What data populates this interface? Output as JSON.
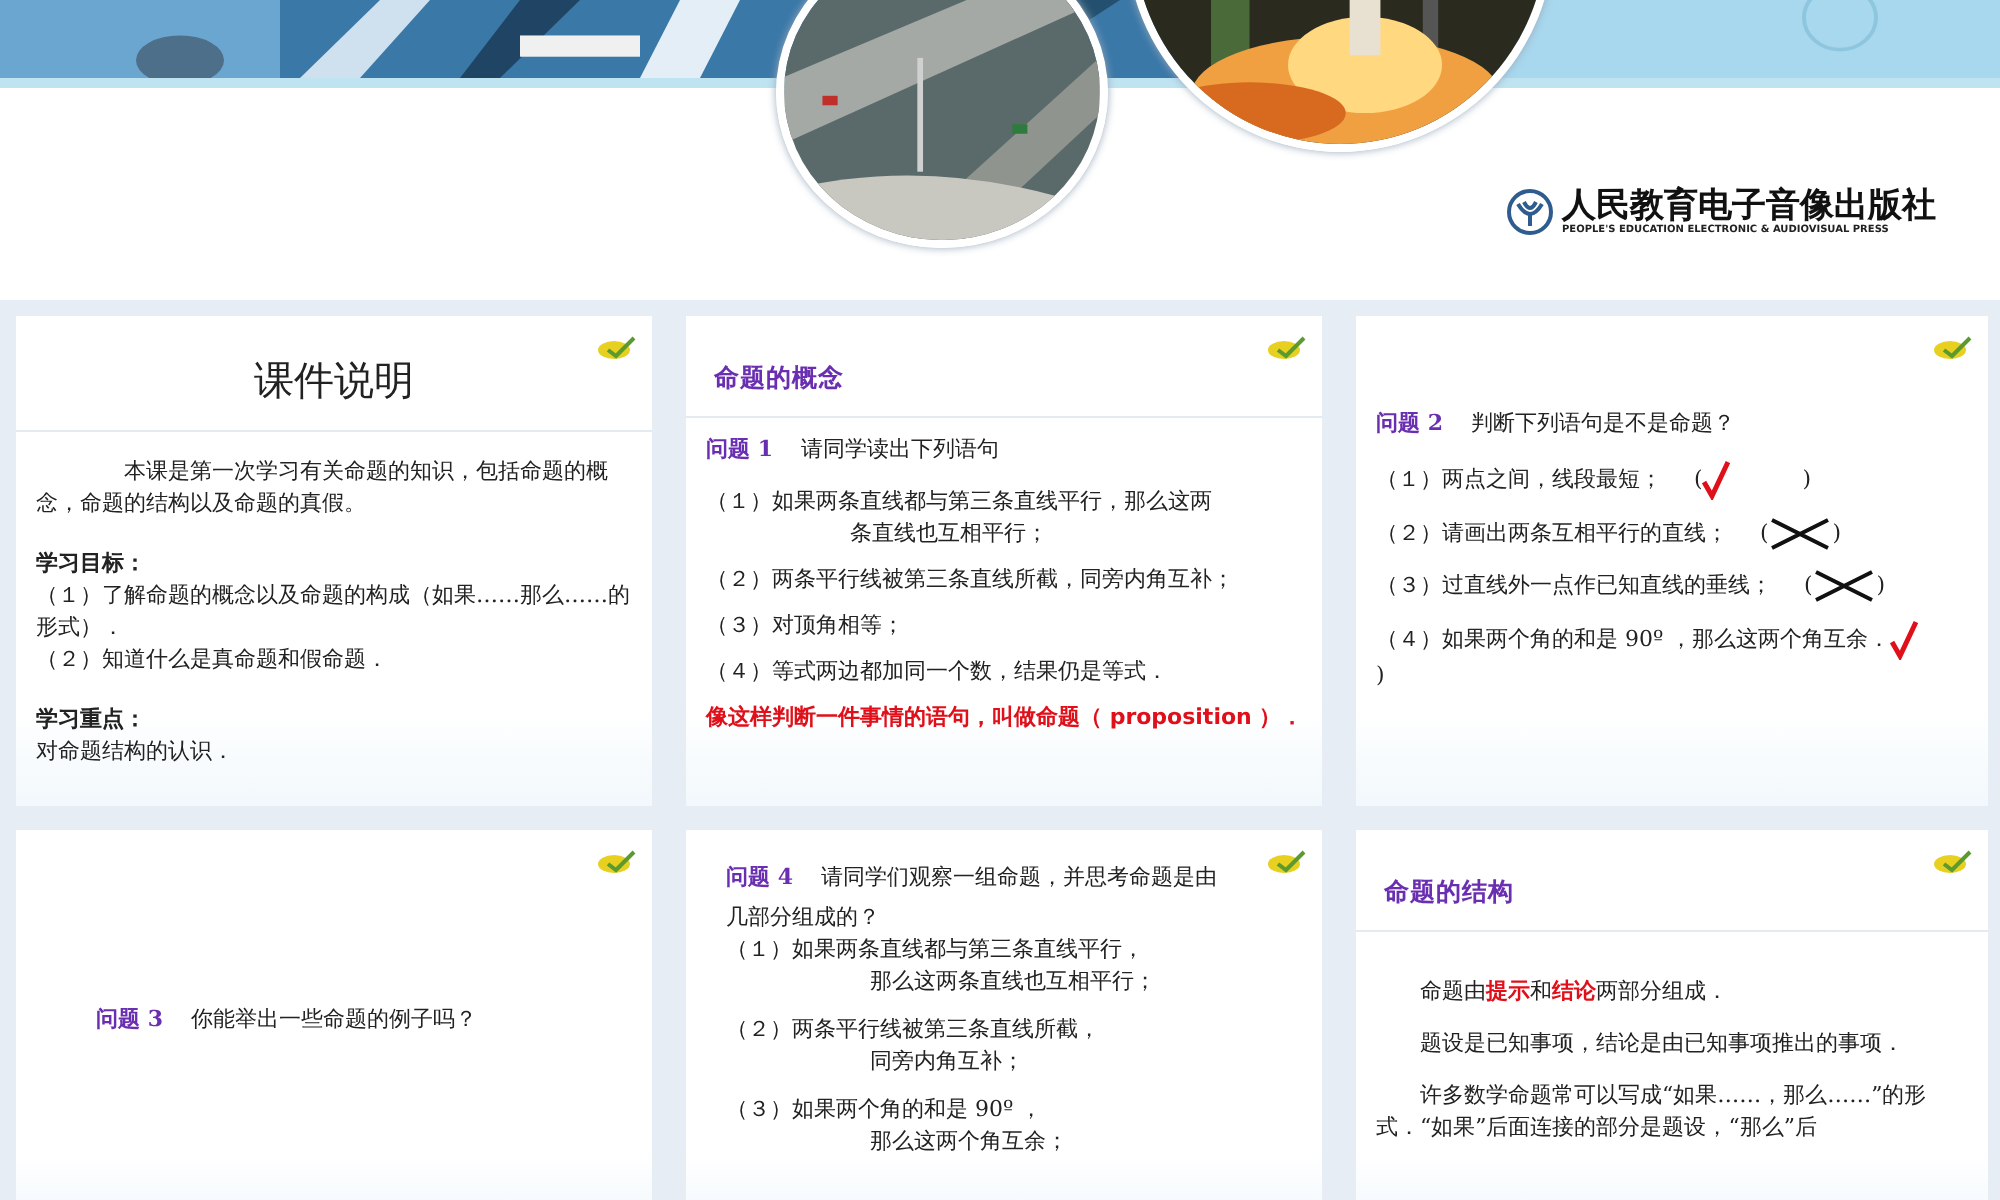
{
  "banner": {
    "publisher": "人民教育电子音像出版社",
    "publisher_en": "PEOPLE'S EDUCATION ELECTRONIC & AUDIOVISUAL PRESS"
  },
  "slides": [
    {
      "kind": "notes",
      "title": "课件说明",
      "blocks": [
        {
          "kind": "paragraph",
          "text": "本课是第一次学习有关命题的知识，包括命题的概念，命题的结构以及命题的真假。"
        },
        {
          "kind": "heading",
          "text": "学习目标："
        },
        {
          "kind": "plain",
          "text": "（１）了解命题的概念以及命题的构成（如果……那么……的形式）．"
        },
        {
          "kind": "plain",
          "text": "（２）知道什么是真命题和假命题．"
        },
        {
          "kind": "heading",
          "text": "学习重点："
        },
        {
          "kind": "plain",
          "text": "对命题结构的认识．"
        }
      ]
    },
    {
      "kind": "section",
      "title": "命题的概念",
      "blocks": [
        {
          "kind": "question",
          "label": "问题 1",
          "text": "请同学读出下列语句"
        },
        {
          "kind": "item",
          "lines": [
            "（１）如果两条直线都与第三条直线平行，那么这两",
            "条直线也互相平行；"
          ]
        },
        {
          "kind": "item",
          "lines": [
            "（２）两条平行线被第三条直线所截，同旁内角互补；"
          ]
        },
        {
          "kind": "item",
          "lines": [
            "（３）对顶角相等；"
          ]
        },
        {
          "kind": "item",
          "lines": [
            "（４）等式两边都加同一个数，结果仍是等式．"
          ]
        },
        {
          "kind": "note",
          "text": "像这样判断一件事情的语句，叫做命题（ proposition ）．"
        }
      ]
    },
    {
      "kind": "exercise",
      "blocks": [
        {
          "kind": "question",
          "label": "问题 2",
          "text": "判断下列语句是不是命题？"
        },
        {
          "kind": "judgement",
          "text": "（１）两点之间，线段最短；",
          "open": "(",
          "close": ")",
          "is_proposition": true
        },
        {
          "kind": "judgement",
          "text": "（２）请画出两条互相平行的直线；",
          "open": "(",
          "close": ")",
          "is_proposition": false
        },
        {
          "kind": "judgement",
          "text": "（３）过直线外一点作已知直线的垂线；",
          "open": "(",
          "close": ")",
          "is_proposition": false
        },
        {
          "kind": "judgement",
          "text": "（４）如果两个角的和是 90º ，那么这两个角互余．",
          "close": ")",
          "is_proposition": true
        }
      ]
    },
    {
      "kind": "prompt",
      "blocks": [
        {
          "kind": "question",
          "label": "问题 3",
          "text": "你能举出一些命题的例子吗？"
        }
      ]
    },
    {
      "kind": "compact",
      "blocks": [
        {
          "kind": "question",
          "label": "问题 4",
          "text": "请同学们观察一组命题，并思考命题是由"
        },
        {
          "kind": "plain",
          "text": "几部分组成的？"
        },
        {
          "kind": "item",
          "lines": [
            "（１）如果两条直线都与第三条直线平行，",
            "那么这两条直线也互相平行；"
          ]
        },
        {
          "kind": "item",
          "lines": [
            "（２）两条平行线被第三条直线所截，",
            "同旁内角互补；"
          ]
        },
        {
          "kind": "item",
          "lines": [
            "（３）如果两个角的和是 90º ，",
            "那么这两个角互余；"
          ]
        }
      ]
    },
    {
      "kind": "section",
      "title": "命题的结构",
      "blocks": [
        {
          "kind": "paragraph",
          "text": "命题由**提示**和**结论**两部分组成．"
        },
        {
          "kind": "paragraph",
          "text": "题设是已知事项，结论是由已知事项推出的事项．"
        },
        {
          "kind": "paragraph",
          "text": "许多数学命题常可以写成“如果……，那么……”的形式．“如果”后面连接的部分是题设，“那么”后"
        }
      ]
    }
  ]
}
